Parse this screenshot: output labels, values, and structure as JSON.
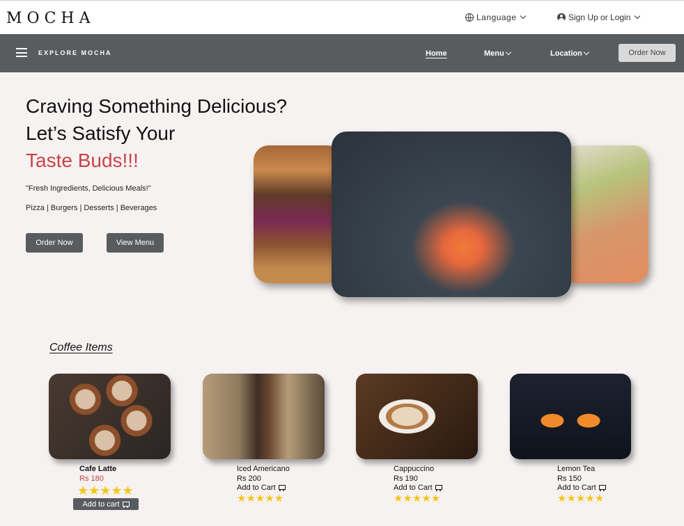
{
  "header": {
    "logo": "MOCHA",
    "language_label": "Language",
    "auth_label": "Sign Up or Login"
  },
  "nav": {
    "brand_label": "EXPLORE MOCHA",
    "home": "Home",
    "menu": "Menu",
    "location": "Location",
    "order_now": "Order Now"
  },
  "hero": {
    "line1": "Craving Something Delicious?",
    "line2": "Let’s Satisfy Your",
    "line3": "Taste Buds!!!",
    "tagline": "\"Fresh Ingredients, Delicious Meals!\"",
    "categories": "Pizza | Burgers | Desserts | Beverages",
    "order_button": "Order Now",
    "menu_button": "View Menu"
  },
  "coffee": {
    "title": "Coffee Items",
    "items": [
      {
        "name": "Cafe Latte",
        "price": "Rs 180",
        "stars": "★★★★★",
        "add_label": "Add to cart"
      },
      {
        "name": "Iced Americano",
        "price": "Rs 200",
        "stars": "★★★★★",
        "add_label": "Add to Cart"
      },
      {
        "name": "Cappuccino",
        "price": "Rs 190",
        "stars": "★★★★★",
        "add_label": "Add to Cart"
      },
      {
        "name": "Lemon Tea",
        "price": "Rs 150",
        "stars": "★★★★★",
        "add_label": "Add to Cart"
      }
    ]
  },
  "colors": {
    "accent": "#c6454a",
    "nav_bg": "#595c5f",
    "star": "#f5c518",
    "page_bg": "#f6f2f1"
  }
}
